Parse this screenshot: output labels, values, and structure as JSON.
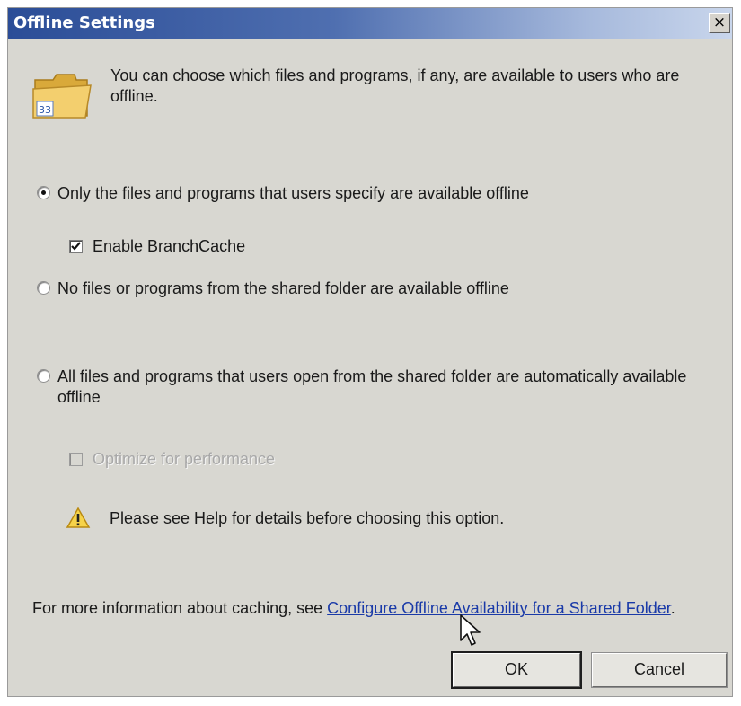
{
  "window": {
    "title": "Offline Settings",
    "close_glyph": "×"
  },
  "intro": {
    "text": "You can choose which files and programs, if any, are available to users who are offline."
  },
  "options": {
    "specify": {
      "label": "Only the files and programs that users specify are available offline",
      "selected": true
    },
    "branchcache": {
      "label": "Enable BranchCache",
      "checked": true
    },
    "none": {
      "label": "No files or programs from the shared folder are available offline",
      "selected": false
    },
    "all": {
      "label": "All files and programs that users open from the shared folder are automatically available offline",
      "selected": false
    },
    "optimize": {
      "label": "Optimize for performance",
      "checked": false,
      "enabled": false
    }
  },
  "warning": {
    "text": "Please see Help for details before choosing this option."
  },
  "footer": {
    "info_prefix": "For more information about caching, see ",
    "link_text": "Configure Offline Availability for a Shared Folder",
    "info_suffix": "."
  },
  "buttons": {
    "ok": "OK",
    "cancel": "Cancel"
  },
  "icons": {
    "folder": "folder-icon",
    "warning": "warning-icon",
    "cursor": "mouse-pointer-icon",
    "close": "close-icon"
  },
  "colors": {
    "title_bar_start": "#2b4d97",
    "dialog_bg": "#d8d7d1",
    "link": "#1a3aa8"
  }
}
